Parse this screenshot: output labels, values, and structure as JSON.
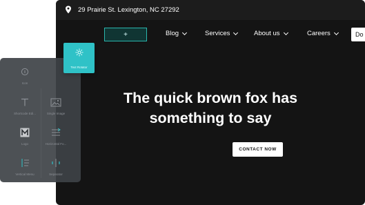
{
  "topbar": {
    "address": "29 Prairie St. Lexington, NC 27292",
    "pin_icon": "map-pin-icon"
  },
  "nav": {
    "add_label": "+",
    "menu": [
      {
        "label": "Blog"
      },
      {
        "label": "Services"
      },
      {
        "label": "About us"
      },
      {
        "label": "Careers"
      }
    ],
    "cta_partial": "Do"
  },
  "hero": {
    "line1": "The quick brown fox has",
    "line2": "something to say",
    "cta": "CONTACT NOW"
  },
  "widgets_panel": {
    "items": [
      {
        "label": "Icon",
        "icon": "info-circle-icon"
      },
      {
        "label": "Shortcode Edi...",
        "icon": "text-t-icon"
      },
      {
        "label": "Single Image",
        "icon": "image-icon"
      },
      {
        "label": "Logo",
        "icon": "logo-m-icon"
      },
      {
        "label": "Horizontal Fo...",
        "icon": "horizontal-form-icon"
      },
      {
        "label": "Vertical Menu",
        "icon": "vertical-menu-icon"
      },
      {
        "label": "Separator",
        "icon": "separator-icon"
      }
    ],
    "dragged": {
      "label": "Text Rotator",
      "icon": "gear-icon"
    }
  },
  "colors": {
    "accent": "#2fc2c7",
    "site_bg": "#141414",
    "panel_bg": "#3e4246"
  }
}
